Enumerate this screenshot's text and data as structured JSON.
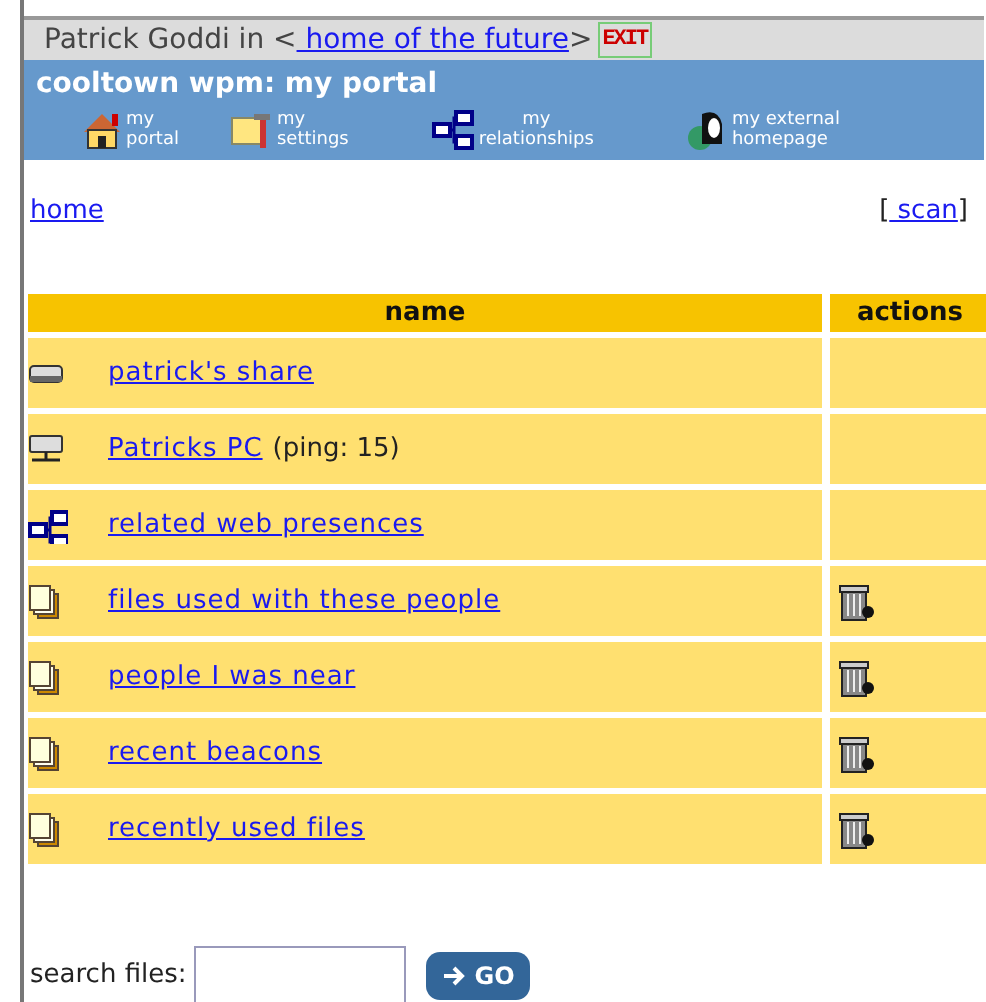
{
  "header": {
    "user": "Patrick Goddi in <",
    "place_link": " home of the future",
    "after": ">",
    "exit": "EXIT"
  },
  "portal": {
    "title": "cooltown wpm: my portal",
    "nav": [
      {
        "kind": "house",
        "lines": [
          "my",
          "portal"
        ]
      },
      {
        "kind": "tools",
        "lines": [
          "my",
          "settings"
        ]
      },
      {
        "kind": "network",
        "lines": [
          "my",
          "relationships"
        ]
      },
      {
        "kind": "person",
        "lines": [
          "my external",
          "homepage"
        ]
      }
    ]
  },
  "breadcrumb": {
    "home": "home",
    "scan_open": "[",
    "scan": " scan",
    "scan_close": "]"
  },
  "table": {
    "columns": [
      "name",
      "actions"
    ],
    "rows": [
      {
        "kind": "drive",
        "link": "patrick's share",
        "has_action": false
      },
      {
        "kind": "computer",
        "link": "Patricks PC",
        "note": "(ping: 15)",
        "has_action": false
      },
      {
        "kind": "network",
        "link": "related web presences",
        "has_action": false
      },
      {
        "kind": "folder",
        "link": "files used with these people",
        "has_action": true
      },
      {
        "kind": "folder",
        "link": "people I was near",
        "has_action": true
      },
      {
        "kind": "folder",
        "link": "recent beacons",
        "has_action": true
      },
      {
        "kind": "folder",
        "link": "recently used files",
        "has_action": true
      }
    ]
  },
  "search": {
    "label": "search files:",
    "button": "GO"
  }
}
